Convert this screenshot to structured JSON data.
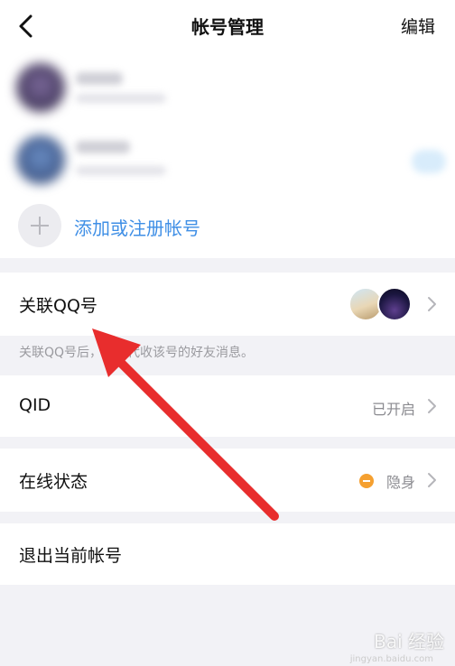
{
  "nav": {
    "title": "帐号管理",
    "edit_label": "编辑"
  },
  "accounts": {
    "add_label": "添加或注册帐号"
  },
  "rows": {
    "linked_qq": {
      "label": "关联QQ号",
      "note": "关联QQ号后，即可代收该号的好友消息。"
    },
    "qid": {
      "label": "QID",
      "value": "已开启"
    },
    "online_status": {
      "label": "在线状态",
      "value": "隐身"
    },
    "logout": {
      "label": "退出当前帐号"
    }
  },
  "watermark": {
    "text": "Bai 经验",
    "sub": "jingyan.baidu.com"
  },
  "colors": {
    "accent": "#3f8fe6",
    "arrow": "#e82d2d",
    "status_hidden": "#f5a030"
  },
  "icons": {
    "back": "chevron-left-icon",
    "chevron": "chevron-right-icon",
    "add": "plus-icon"
  }
}
